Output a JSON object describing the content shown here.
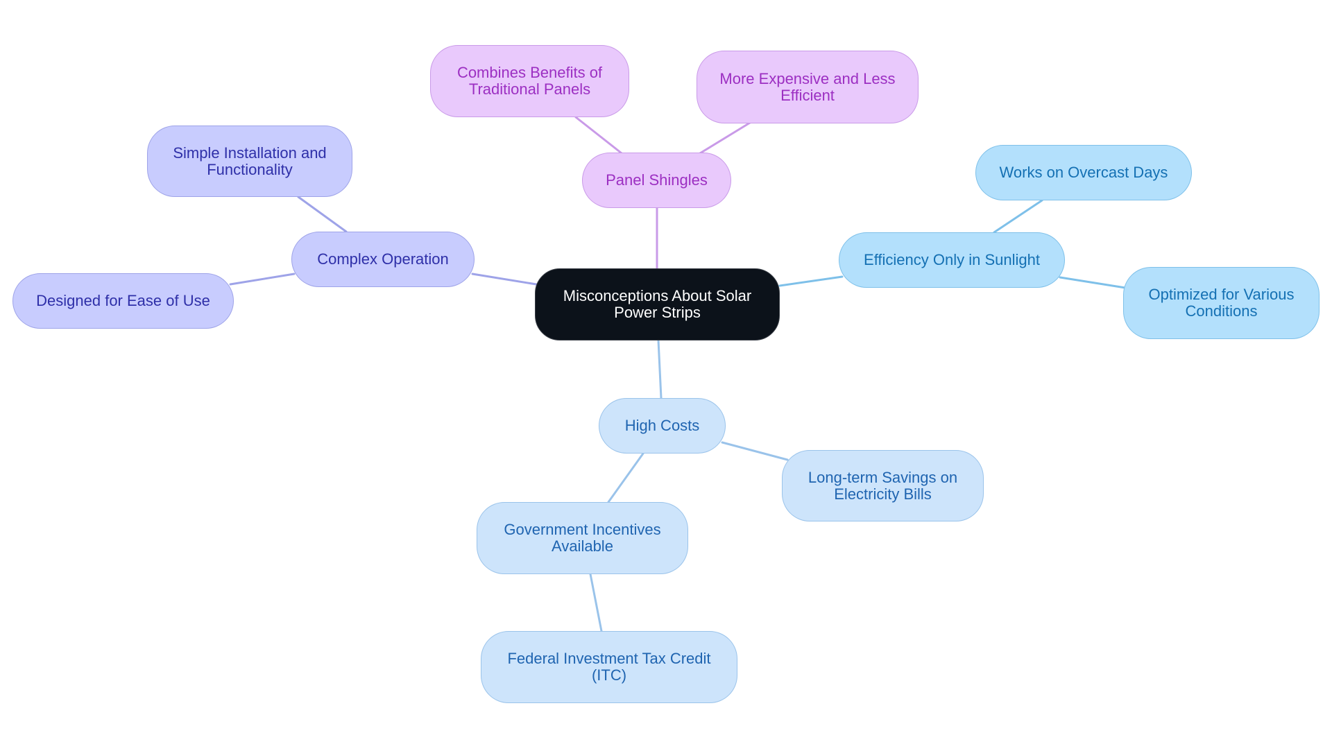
{
  "diagram": {
    "type": "mind-map",
    "colors": {
      "root_fill": "#0c121a",
      "root_text": "#ffffff",
      "panel_shingles_branch": {
        "fill": "#e9c9fc",
        "stroke": "#c99ae8",
        "text": "#9c2fc2",
        "edge": "#c99ae8"
      },
      "complex_operation_branch": {
        "fill": "#c8ccfe",
        "stroke": "#9ea3e8",
        "text": "#2e2fa8",
        "edge": "#9ea3e8"
      },
      "efficiency_branch": {
        "fill": "#b3e0fc",
        "stroke": "#7ec0e9",
        "text": "#1470b3",
        "edge": "#7ec0e9"
      },
      "high_costs_branch": {
        "fill": "#cde4fb",
        "stroke": "#9ac3ea",
        "text": "#1f64b0",
        "edge": "#9ac3ea"
      }
    },
    "root": {
      "label": "Misconceptions About Solar\nPower Strips"
    },
    "nodes": {
      "panel_shingles": {
        "label": "Panel Shingles"
      },
      "combines_benefits": {
        "label": "Combines Benefits of\nTraditional Panels"
      },
      "more_expensive": {
        "label": "More Expensive and Less\nEfficient"
      },
      "complex_operation": {
        "label": "Complex Operation"
      },
      "simple_installation": {
        "label": "Simple Installation and\nFunctionality"
      },
      "designed_for_ease": {
        "label": "Designed for Ease of Use"
      },
      "efficiency_sunlight": {
        "label": "Efficiency Only in Sunlight"
      },
      "works_overcast": {
        "label": "Works on Overcast Days"
      },
      "optimized_conditions": {
        "label": "Optimized for Various\nConditions"
      },
      "high_costs": {
        "label": "High Costs"
      },
      "long_term_savings": {
        "label": "Long-term Savings on\nElectricity Bills"
      },
      "government_incentives": {
        "label": "Government Incentives\nAvailable"
      },
      "federal_itc": {
        "label": "Federal Investment Tax Credit\n(ITC)"
      }
    },
    "edges": [
      {
        "from": "root",
        "to": "panel_shingles",
        "branch": "panel_shingles_branch"
      },
      {
        "from": "panel_shingles",
        "to": "combines_benefits",
        "branch": "panel_shingles_branch"
      },
      {
        "from": "panel_shingles",
        "to": "more_expensive",
        "branch": "panel_shingles_branch"
      },
      {
        "from": "root",
        "to": "complex_operation",
        "branch": "complex_operation_branch"
      },
      {
        "from": "complex_operation",
        "to": "simple_installation",
        "branch": "complex_operation_branch"
      },
      {
        "from": "complex_operation",
        "to": "designed_for_ease",
        "branch": "complex_operation_branch"
      },
      {
        "from": "root",
        "to": "efficiency_sunlight",
        "branch": "efficiency_branch"
      },
      {
        "from": "efficiency_sunlight",
        "to": "works_overcast",
        "branch": "efficiency_branch"
      },
      {
        "from": "efficiency_sunlight",
        "to": "optimized_conditions",
        "branch": "efficiency_branch"
      },
      {
        "from": "root",
        "to": "high_costs",
        "branch": "high_costs_branch"
      },
      {
        "from": "high_costs",
        "to": "long_term_savings",
        "branch": "high_costs_branch"
      },
      {
        "from": "high_costs",
        "to": "government_incentives",
        "branch": "high_costs_branch"
      },
      {
        "from": "government_incentives",
        "to": "federal_itc",
        "branch": "high_costs_branch"
      }
    ]
  }
}
